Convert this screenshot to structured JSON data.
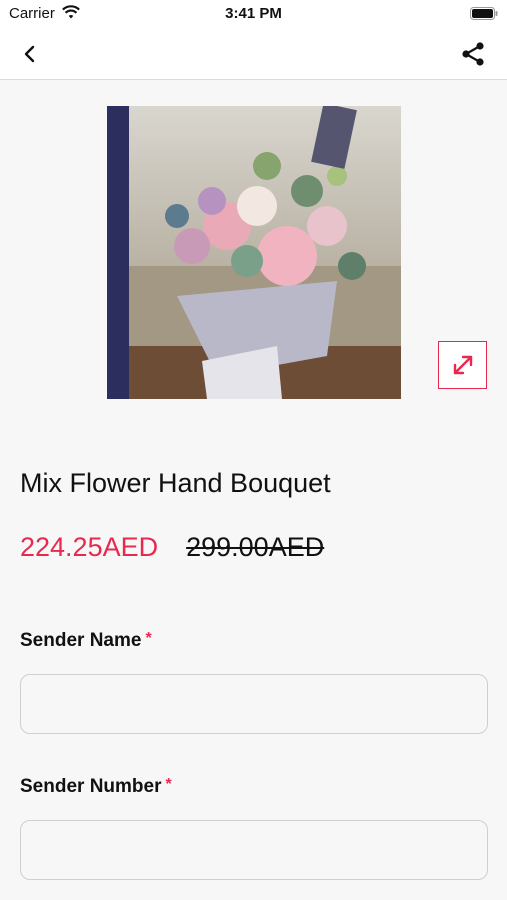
{
  "status_bar": {
    "carrier": "Carrier",
    "time": "3:41 PM"
  },
  "nav": {
    "back_icon": "chevron-left-icon",
    "share_icon": "share-icon"
  },
  "product": {
    "title": "Mix Flower Hand Bouquet",
    "price_sale": "224.25AED",
    "price_original": "299.00AED",
    "expand_icon": "expand-arrows-icon"
  },
  "form": {
    "sender_name": {
      "label": "Sender Name",
      "required": "*",
      "value": "",
      "placeholder": ""
    },
    "sender_number": {
      "label": "Sender Number",
      "required": "*",
      "value": "",
      "placeholder": ""
    }
  },
  "colors": {
    "accent": "#e8294f",
    "background": "#f7f7f7"
  }
}
